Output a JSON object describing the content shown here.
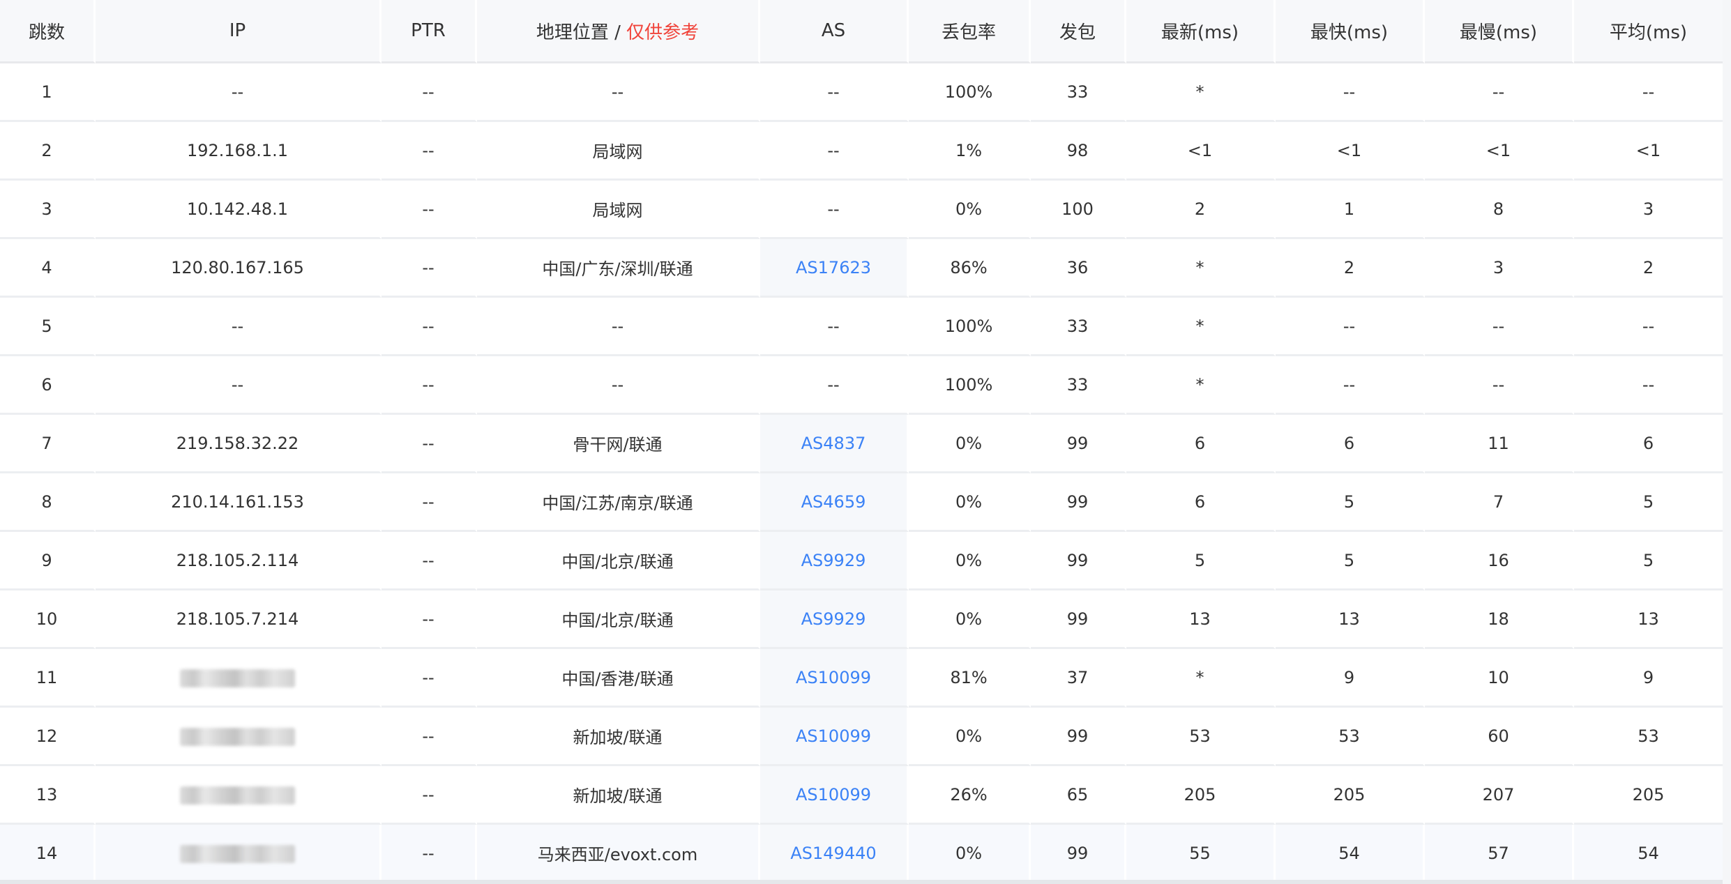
{
  "headers": {
    "hop": "跳数",
    "ip": "IP",
    "ptr": "PTR",
    "geo": "地理位置",
    "geo_sep": " / ",
    "geo_note": "仅供参考",
    "as": "AS",
    "loss": "丢包率",
    "sent": "发包",
    "last": "最新(ms)",
    "best": "最快(ms)",
    "worst": "最慢(ms)",
    "avg": "平均(ms)"
  },
  "colors": {
    "link": "#3b82f6",
    "warn": "#f0433a"
  },
  "rows": [
    {
      "hop": "1",
      "ip": "--",
      "ip_masked": false,
      "ptr": "--",
      "geo": "--",
      "as": "--",
      "as_link": false,
      "loss": "100%",
      "sent": "33",
      "last": "*",
      "best": "--",
      "worst": "--",
      "avg": "--"
    },
    {
      "hop": "2",
      "ip": "192.168.1.1",
      "ip_masked": false,
      "ptr": "--",
      "geo": "局域网",
      "as": "--",
      "as_link": false,
      "loss": "1%",
      "sent": "98",
      "last": "<1",
      "best": "<1",
      "worst": "<1",
      "avg": "<1"
    },
    {
      "hop": "3",
      "ip": "10.142.48.1",
      "ip_masked": false,
      "ptr": "--",
      "geo": "局域网",
      "as": "--",
      "as_link": false,
      "loss": "0%",
      "sent": "100",
      "last": "2",
      "best": "1",
      "worst": "8",
      "avg": "3"
    },
    {
      "hop": "4",
      "ip": "120.80.167.165",
      "ip_masked": false,
      "ptr": "--",
      "geo": "中国/广东/深圳/联通",
      "as": "AS17623",
      "as_link": true,
      "loss": "86%",
      "sent": "36",
      "last": "*",
      "best": "2",
      "worst": "3",
      "avg": "2"
    },
    {
      "hop": "5",
      "ip": "--",
      "ip_masked": false,
      "ptr": "--",
      "geo": "--",
      "as": "--",
      "as_link": false,
      "loss": "100%",
      "sent": "33",
      "last": "*",
      "best": "--",
      "worst": "--",
      "avg": "--"
    },
    {
      "hop": "6",
      "ip": "--",
      "ip_masked": false,
      "ptr": "--",
      "geo": "--",
      "as": "--",
      "as_link": false,
      "loss": "100%",
      "sent": "33",
      "last": "*",
      "best": "--",
      "worst": "--",
      "avg": "--"
    },
    {
      "hop": "7",
      "ip": "219.158.32.22",
      "ip_masked": false,
      "ptr": "--",
      "geo": "骨干网/联通",
      "as": "AS4837",
      "as_link": true,
      "loss": "0%",
      "sent": "99",
      "last": "6",
      "best": "6",
      "worst": "11",
      "avg": "6"
    },
    {
      "hop": "8",
      "ip": "210.14.161.153",
      "ip_masked": false,
      "ptr": "--",
      "geo": "中国/江苏/南京/联通",
      "as": "AS4659",
      "as_link": true,
      "loss": "0%",
      "sent": "99",
      "last": "6",
      "best": "5",
      "worst": "7",
      "avg": "5"
    },
    {
      "hop": "9",
      "ip": "218.105.2.114",
      "ip_masked": false,
      "ptr": "--",
      "geo": "中国/北京/联通",
      "as": "AS9929",
      "as_link": true,
      "loss": "0%",
      "sent": "99",
      "last": "5",
      "best": "5",
      "worst": "16",
      "avg": "5"
    },
    {
      "hop": "10",
      "ip": "218.105.7.214",
      "ip_masked": false,
      "ptr": "--",
      "geo": "中国/北京/联通",
      "as": "AS9929",
      "as_link": true,
      "loss": "0%",
      "sent": "99",
      "last": "13",
      "best": "13",
      "worst": "18",
      "avg": "13"
    },
    {
      "hop": "11",
      "ip": "",
      "ip_masked": true,
      "ptr": "--",
      "geo": "中国/香港/联通",
      "as": "AS10099",
      "as_link": true,
      "loss": "81%",
      "sent": "37",
      "last": "*",
      "best": "9",
      "worst": "10",
      "avg": "9"
    },
    {
      "hop": "12",
      "ip": "",
      "ip_masked": true,
      "ptr": "--",
      "geo": "新加坡/联通",
      "as": "AS10099",
      "as_link": true,
      "loss": "0%",
      "sent": "99",
      "last": "53",
      "best": "53",
      "worst": "60",
      "avg": "53"
    },
    {
      "hop": "13",
      "ip": "",
      "ip_masked": true,
      "ptr": "--",
      "geo": "新加坡/联通",
      "as": "AS10099",
      "as_link": true,
      "loss": "26%",
      "sent": "65",
      "last": "205",
      "best": "205",
      "worst": "207",
      "avg": "205"
    },
    {
      "hop": "14",
      "ip": "",
      "ip_masked": true,
      "ptr": "--",
      "geo": "马来西亚/evoxt.com",
      "as": "AS149440",
      "as_link": true,
      "loss": "0%",
      "sent": "99",
      "last": "55",
      "best": "54",
      "worst": "57",
      "avg": "54"
    }
  ]
}
